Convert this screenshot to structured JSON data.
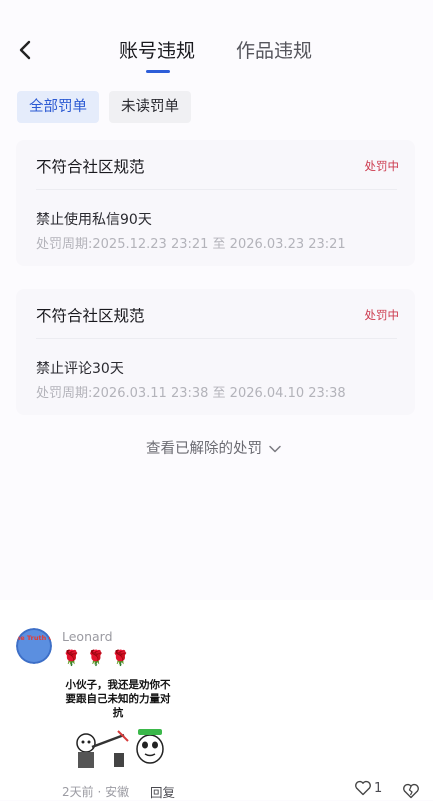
{
  "header": {
    "tabs": [
      {
        "label": "账号违规",
        "active": true
      },
      {
        "label": "作品违规",
        "active": false
      }
    ],
    "accent_color": "#2d5dd8"
  },
  "filters": {
    "all_label": "全部罚单",
    "unread_label": "未读罚单"
  },
  "penalties": [
    {
      "title": "不符合社区规范",
      "status": "处罚中",
      "description": "禁止使用私信90天",
      "period": "处罚周期:2025.12.23 23:21 至 2026.03.23 23:21"
    },
    {
      "title": "不符合社区规范",
      "status": "处罚中",
      "description": "禁止评论30天",
      "period": "处罚周期:2026.03.11 23:38 至 2026.04.10 23:38"
    }
  ],
  "view_resolved_label": "查看已解除的处罚",
  "comment": {
    "avatar_text": "The Truth Of",
    "username": "Leonard",
    "emoji": "🌹🌹🌹",
    "meme_text": "小伙子，我还是劝你不要跟自己未知的力量对抗",
    "meta": "2天前 · 安徽",
    "reply_label": "回复",
    "like_count": "1"
  },
  "icons": {
    "back": "chevron-left-icon",
    "expand": "chevron-down-icon",
    "like": "heart-outline-icon",
    "dislike": "broken-heart-icon"
  },
  "status_color": "#cc3a4e"
}
